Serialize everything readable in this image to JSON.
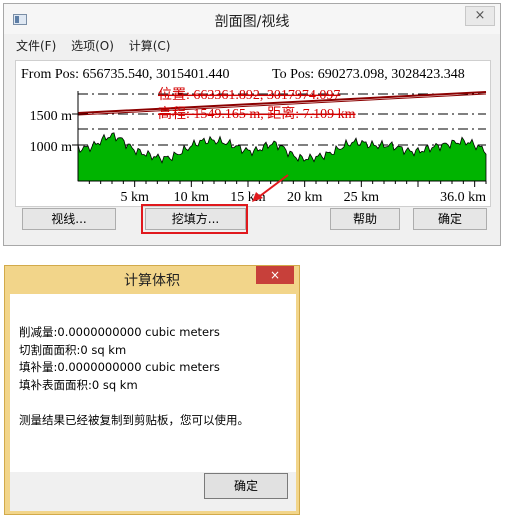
{
  "profile_window": {
    "title": "剖面图/视线",
    "close_glyph": "×",
    "menu": [
      "文件(F)",
      "选项(O)",
      "计算(C)"
    ],
    "from_pos_text": "From Pos: 656735.540, 3015401.440",
    "to_pos_text": "To Pos: 690273.098, 3028423.348",
    "y_ticks": [
      {
        "label": "1500 m",
        "value": 1500
      },
      {
        "label": "1000 m",
        "value": 1000
      }
    ],
    "x_ticks": [
      {
        "label": "5 km",
        "value": 5
      },
      {
        "label": "10 km",
        "value": 10
      },
      {
        "label": "15 km",
        "value": 15
      },
      {
        "label": "20 km",
        "value": 20
      },
      {
        "label": "25 km",
        "value": 25
      },
      {
        "label": "36.0 km",
        "value": 36.0
      }
    ],
    "cursor_position_text": "位置: 663361.892, 3017974.097",
    "cursor_elevation_text": "高程: 1549.165 m, 距离: 7.109 km",
    "buttons": {
      "sight_line": "视线...",
      "cut_fill": "挖填方...",
      "help": "帮助",
      "ok": "确定"
    },
    "colors": {
      "terrain_fill": "#00b400",
      "sight_line": "#8b0000",
      "annotation": "#d40000",
      "highlight_box": "#e0191d"
    }
  },
  "volume_dialog": {
    "title": "计算体积",
    "close_glyph": "×",
    "lines": [
      "削减量:0.0000000000 cubic meters",
      "切割面面积:0 sq km",
      "填补量:0.0000000000 cubic meters",
      "填补表面面积:0 sq km"
    ],
    "notice": "测量结果已经被复制到剪贴板，您可以使用。",
    "ok": "确定",
    "colors": {
      "frame": "#f2d58a",
      "close": "#c7403a"
    }
  }
}
